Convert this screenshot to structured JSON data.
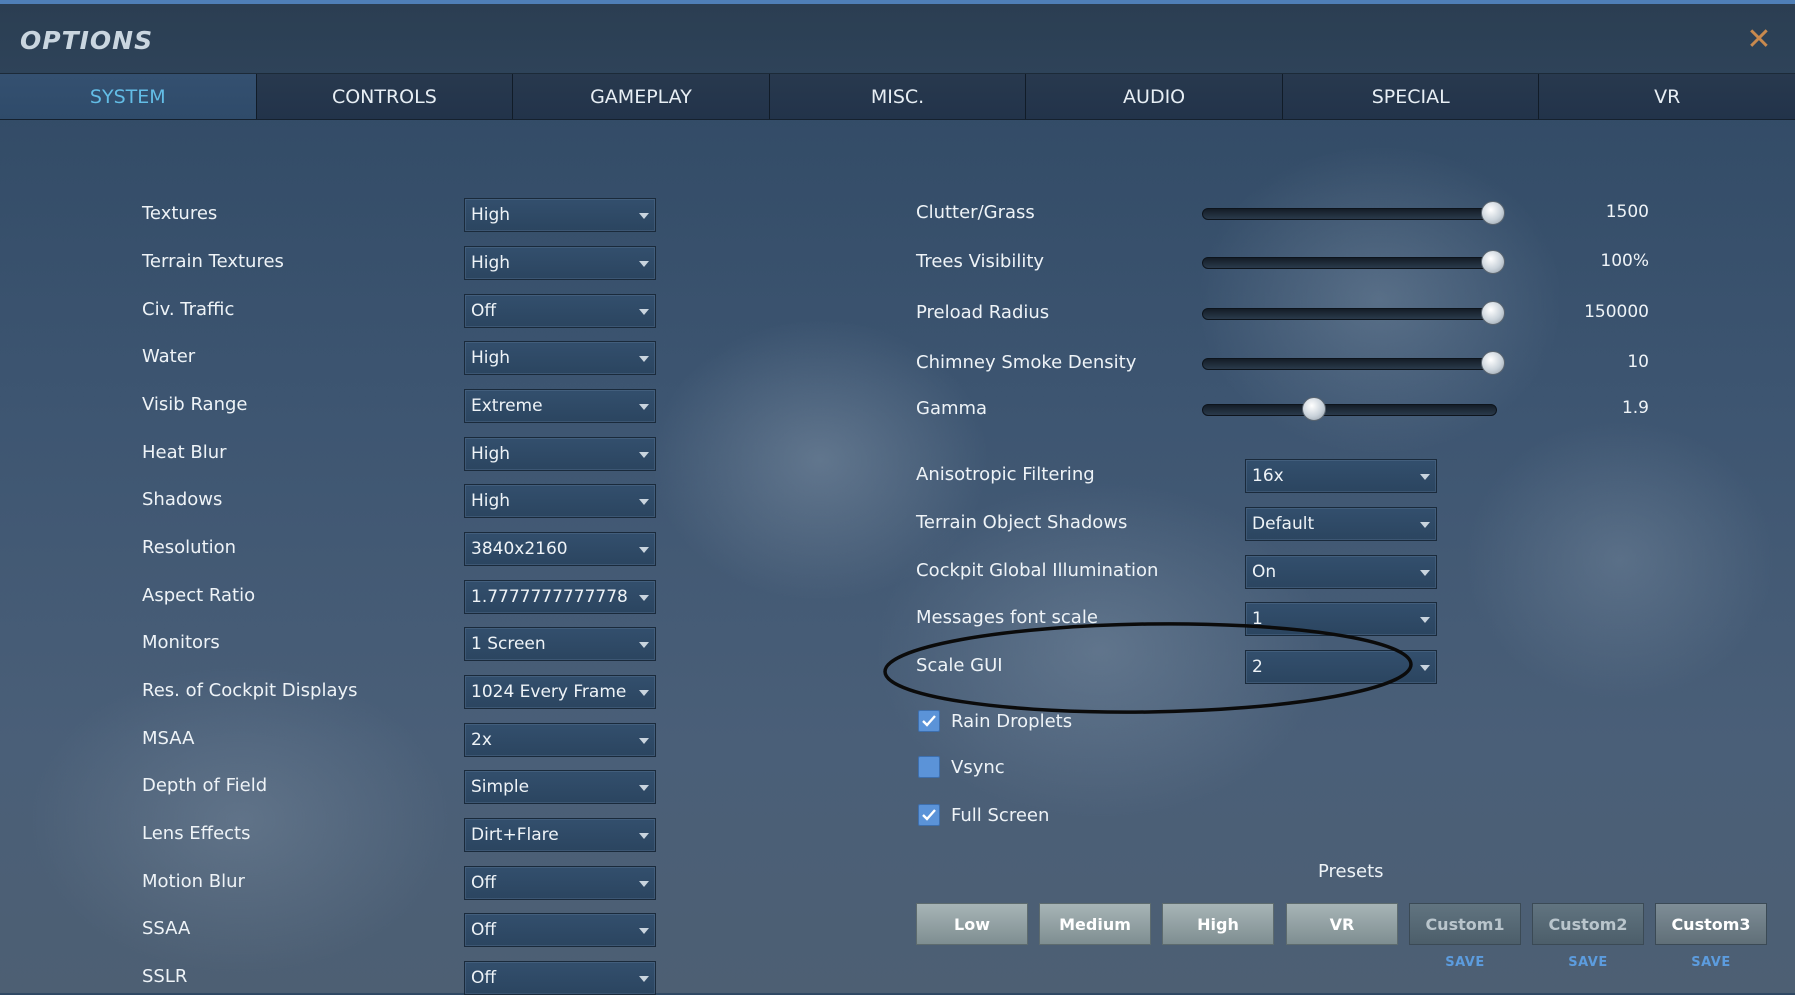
{
  "window": {
    "title": "OPTIONS",
    "close_icon": "close-icon"
  },
  "tabs": [
    {
      "label": "SYSTEM",
      "active": true
    },
    {
      "label": "CONTROLS"
    },
    {
      "label": "GAMEPLAY"
    },
    {
      "label": "MISC."
    },
    {
      "label": "AUDIO"
    },
    {
      "label": "SPECIAL"
    },
    {
      "label": "VR"
    }
  ],
  "left_settings": [
    {
      "label": "Textures",
      "value": "High"
    },
    {
      "label": "Terrain Textures",
      "value": "High"
    },
    {
      "label": "Civ. Traffic",
      "value": "Off"
    },
    {
      "label": "Water",
      "value": "High"
    },
    {
      "label": "Visib Range",
      "value": "Extreme"
    },
    {
      "label": "Heat Blur",
      "value": "High"
    },
    {
      "label": "Shadows",
      "value": "High"
    },
    {
      "label": "Resolution",
      "value": "3840x2160"
    },
    {
      "label": "Aspect Ratio",
      "value": "1.7777777777778"
    },
    {
      "label": "Monitors",
      "value": "1 Screen"
    },
    {
      "label": "Res. of Cockpit Displays",
      "value": "1024 Every Frame"
    },
    {
      "label": "MSAA",
      "value": "2x"
    },
    {
      "label": "Depth of Field",
      "value": "Simple"
    },
    {
      "label": "Lens Effects",
      "value": "Dirt+Flare"
    },
    {
      "label": "Motion Blur",
      "value": "Off"
    },
    {
      "label": "SSAA",
      "value": "Off"
    },
    {
      "label": "SSLR",
      "value": "Off"
    }
  ],
  "sliders": [
    {
      "label": "Clutter/Grass",
      "value": "1500",
      "level": 1.0
    },
    {
      "label": "Trees Visibility",
      "value": "100%",
      "level": 1.0
    },
    {
      "label": "Preload Radius",
      "value": "150000",
      "level": 1.0
    },
    {
      "label": "Chimney Smoke Density",
      "value": "10",
      "level": 1.0
    },
    {
      "label": "Gamma",
      "value": "1.9",
      "level": 0.37
    }
  ],
  "right_settings": [
    {
      "label": "Anisotropic Filtering",
      "value": "16x"
    },
    {
      "label": "Terrain Object Shadows",
      "value": "Default"
    },
    {
      "label": "Cockpit Global Illumination",
      "value": "On"
    },
    {
      "label": "Messages font scale",
      "value": "1"
    },
    {
      "label": "Scale GUI",
      "value": "2"
    }
  ],
  "checkboxes": [
    {
      "label": "Rain Droplets",
      "checked": true
    },
    {
      "label": "Vsync",
      "checked": false
    },
    {
      "label": "Full Screen",
      "checked": true
    }
  ],
  "presets": {
    "title": "Presets",
    "buttons": [
      "Low",
      "Medium",
      "High",
      "VR"
    ],
    "custom": [
      {
        "label": "Custom1",
        "save": "SAVE"
      },
      {
        "label": "Custom2",
        "save": "SAVE"
      },
      {
        "label": "Custom3",
        "save": "SAVE"
      }
    ]
  },
  "colors": {
    "accent_tab": "#63bde6",
    "checkbox": "#5b93d8",
    "close": "#c8894e",
    "save_link": "#5c9cde"
  }
}
